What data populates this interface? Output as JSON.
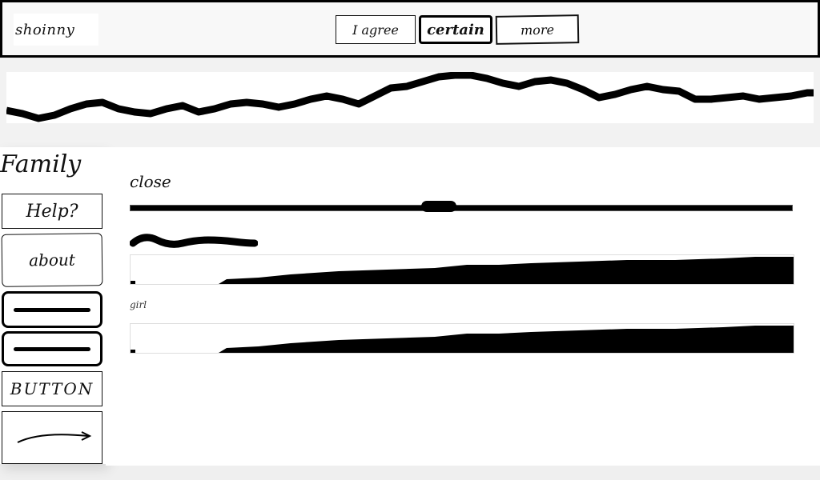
{
  "header": {
    "logo_text": "shoinny",
    "buttons": [
      {
        "label": "I agree"
      },
      {
        "label": "certain"
      },
      {
        "label": "more"
      }
    ]
  },
  "sidebar": {
    "title": "Family",
    "items": [
      {
        "label": "Help?"
      },
      {
        "label": "about"
      },
      {
        "icon": "line-icon"
      },
      {
        "icon": "line-icon"
      },
      {
        "label": "BUTTON"
      },
      {
        "icon": "arrow-icon"
      }
    ]
  },
  "main": {
    "label1": "close",
    "slider_value": 0.45,
    "label2": "girl"
  },
  "colors": {
    "ink": "#000000",
    "paper": "#ffffff",
    "background": "#efefef"
  }
}
